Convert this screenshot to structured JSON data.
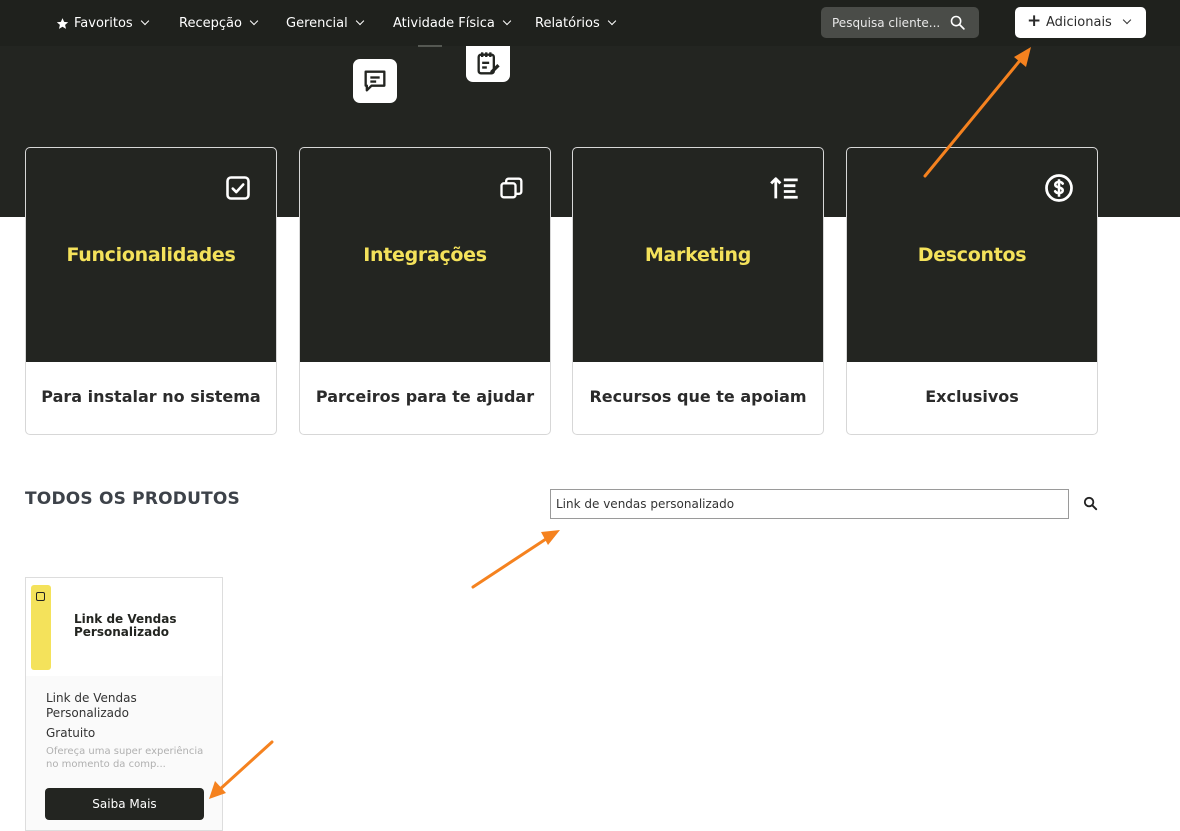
{
  "nav": {
    "items": [
      {
        "label": "Favoritos",
        "icon": "star-icon"
      },
      {
        "label": "Recepção"
      },
      {
        "label": "Gerencial"
      },
      {
        "label": "Atividade Física"
      },
      {
        "label": "Relatórios"
      }
    ],
    "search_placeholder": "Pesquisa cliente...",
    "add_label": "Adicionais"
  },
  "categories": [
    {
      "title": "Funcionalidades",
      "subtitle": "Para instalar no sistema",
      "icon": "checkbox-icon"
    },
    {
      "title": "Integrações",
      "subtitle": "Parceiros para te ajudar",
      "icon": "copy-icon"
    },
    {
      "title": "Marketing",
      "subtitle": "Recursos que te apoiam",
      "icon": "sort-list-icon"
    },
    {
      "title": "Descontos",
      "subtitle": "Exclusivos",
      "icon": "dollar-circle-icon"
    }
  ],
  "products_section": {
    "title": "TODOS OS PRODUTOS",
    "search_value": "Link de vendas personalizado"
  },
  "products": [
    {
      "banner_line1": "Link de Vendas",
      "banner_line2": "Personalizado",
      "name_line1": "Link de Vendas",
      "name_line2": "Personalizado",
      "price": "Gratuito",
      "description": "Ofereça uma super experiência no momento da comp...",
      "cta": "Saiba Mais"
    }
  ],
  "colors": {
    "dark": "#232521",
    "accent_yellow": "#f4e25b",
    "annotation_orange": "#f5821f"
  }
}
